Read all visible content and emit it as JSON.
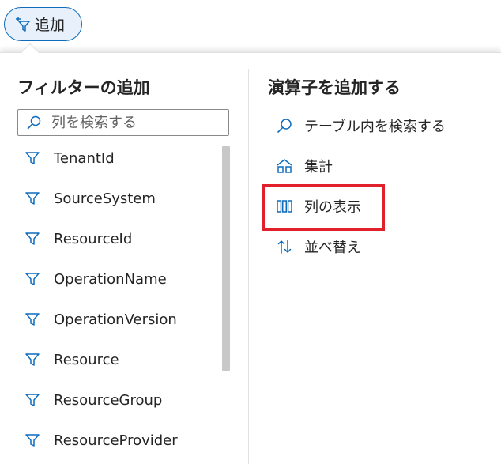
{
  "toolbar": {
    "add_label": "追加"
  },
  "filter_panel": {
    "title": "フィルターの追加",
    "search_placeholder": "列を検索する",
    "columns": [
      "TenantId",
      "SourceSystem",
      "ResourceId",
      "OperationName",
      "OperationVersion",
      "Resource",
      "ResourceGroup",
      "ResourceProvider"
    ]
  },
  "operator_panel": {
    "title": "演算子を追加する",
    "items": [
      {
        "label": "テーブル内を検索する",
        "icon": "search-icon"
      },
      {
        "label": "集計",
        "icon": "aggregate-icon"
      },
      {
        "label": "列の表示",
        "icon": "columns-icon"
      },
      {
        "label": "並べ替え",
        "icon": "sort-icon"
      }
    ]
  },
  "colors": {
    "accent": "#0f6cbd",
    "highlight": "#e0202a"
  }
}
